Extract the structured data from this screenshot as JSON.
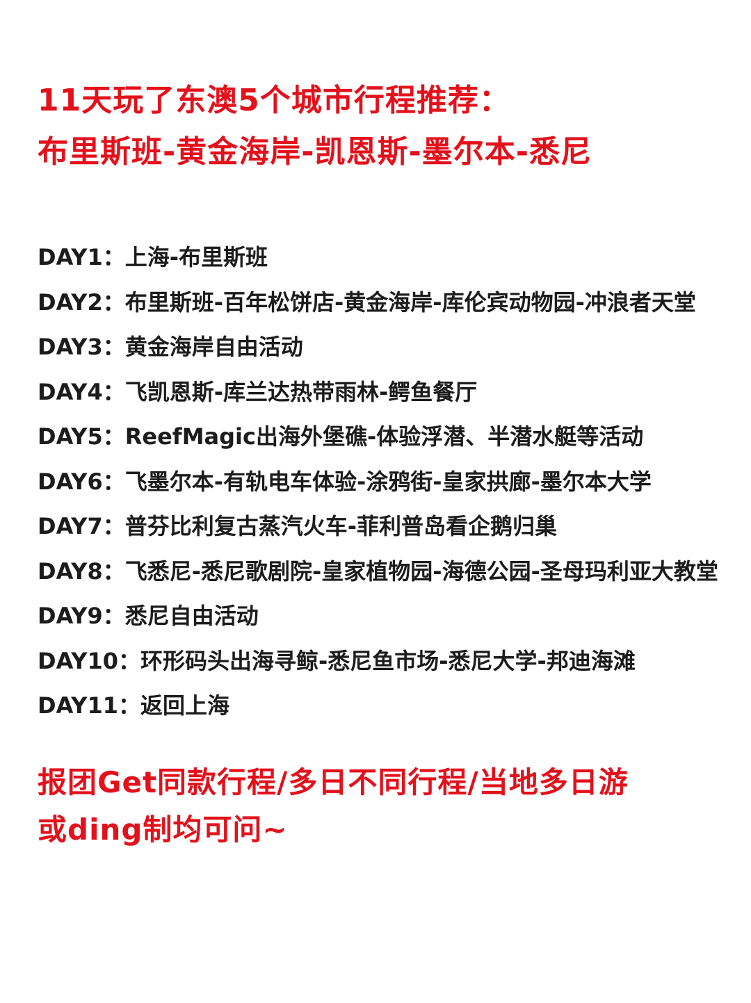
{
  "header": {
    "title_line1": "11天玩了东澳5个城市行程推荐：",
    "title_line2": "布里斯班-黄金海岸-凯恩斯-墨尔本-悉尼"
  },
  "itinerary": [
    {
      "label": "DAY1：",
      "text": "上海-布里斯班"
    },
    {
      "label": "DAY2：",
      "text": "布里斯班-百年松饼店-黄金海岸-库伦宾动物园-冲浪者天堂"
    },
    {
      "label": "DAY3：",
      "text": "黄金海岸自由活动"
    },
    {
      "label": "DAY4：",
      "text": "飞凯恩斯-库兰达热带雨林-鳄鱼餐厅"
    },
    {
      "label": "DAY5：",
      "text": "ReefMagic出海外堡礁-体验浮潜、半潜水艇等活动"
    },
    {
      "label": "DAY6：",
      "text": "飞墨尔本-有轨电车体验-涂鸦街-皇家拱廊-墨尔本大学"
    },
    {
      "label": "DAY7：",
      "text": "普芬比利复古蒸汽火车-菲利普岛看企鹅归巢"
    },
    {
      "label": "DAY8：",
      "text": "飞悉尼-悉尼歌剧院-皇家植物园-海德公园-圣母玛利亚大教堂"
    },
    {
      "label": "DAY9：",
      "text": "悉尼自由活动"
    },
    {
      "label": "DAY10：",
      "text": "环形码头出海寻鲸-悉尼鱼市场-悉尼大学-邦迪海滩"
    },
    {
      "label": "DAY11：",
      "text": "返回上海"
    }
  ],
  "footer": {
    "cta_line1": "报团Get同款行程/多日不同行程/当地多日游",
    "cta_line2": "或ding制均可问~"
  }
}
